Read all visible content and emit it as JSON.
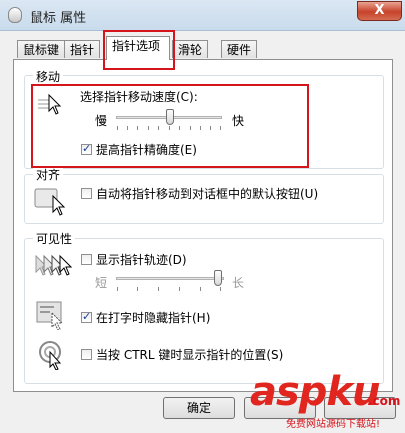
{
  "window": {
    "title": "鼠标 属性",
    "close_glyph": "X"
  },
  "tabs": [
    {
      "label": "鼠标键"
    },
    {
      "label": "指针"
    },
    {
      "label": "指针选项"
    },
    {
      "label": "滑轮"
    },
    {
      "label": "硬件"
    }
  ],
  "active_tab": "指针选项",
  "motion": {
    "title": "移动",
    "speed_label": "选择指针移动速度(C):",
    "slow": "慢",
    "fast": "快",
    "speed_level": 0.5,
    "precision_label": "提高指针精确度(E)",
    "precision_checked": true
  },
  "snap": {
    "title": "对齐",
    "label": "自动将指针移动到对话框中的默认按钮(U)",
    "checked": false
  },
  "visibility": {
    "title": "可见性",
    "trails_label": "显示指针轨迹(D)",
    "trails_checked": false,
    "short": "短",
    "long": "长",
    "trail_level": 1.0,
    "hide_label": "在打字时隐藏指针(H)",
    "hide_checked": true,
    "ctrl_label": "当按 CTRL 键时显示指针的位置(S)",
    "ctrl_checked": false
  },
  "buttons": {
    "ok": "确定"
  },
  "watermark": {
    "brand": "aspku",
    "tld": ".com",
    "slogan": "免费网站源码下载站!"
  },
  "colors": {
    "highlight": "#d6141b",
    "brand_red": "#e0261f"
  }
}
